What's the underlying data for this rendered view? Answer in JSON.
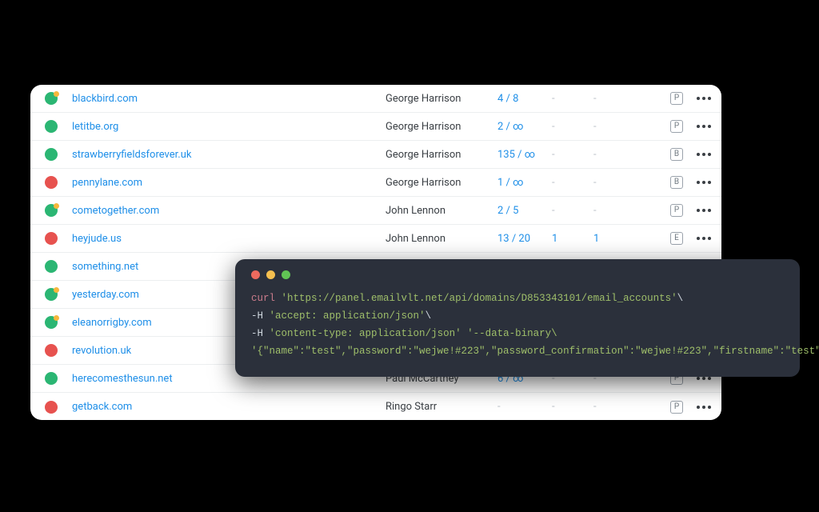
{
  "rows": [
    {
      "status": "green",
      "accent": "yellow",
      "domain": "blackbird.com",
      "owner": "George Harrison",
      "quota": "4 / 8",
      "m1": "-",
      "m2": "-",
      "badge": "P"
    },
    {
      "status": "green",
      "accent": "",
      "domain": "letitbe.org",
      "owner": "George Harrison",
      "quota": "2 / ∞",
      "m1": "-",
      "m2": "-",
      "badge": "P"
    },
    {
      "status": "green",
      "accent": "",
      "domain": "strawberryfieldsforever.uk",
      "owner": "George Harrison",
      "quota": "135 / ∞",
      "m1": "-",
      "m2": "-",
      "badge": "B"
    },
    {
      "status": "red",
      "accent": "",
      "domain": "pennylane.com",
      "owner": "George Harrison",
      "quota": "1 / ∞",
      "m1": "-",
      "m2": "-",
      "badge": "B"
    },
    {
      "status": "green",
      "accent": "yellow",
      "domain": "cometogether.com",
      "owner": "John Lennon",
      "quota": "2 / 5",
      "m1": "-",
      "m2": "-",
      "badge": "P"
    },
    {
      "status": "red",
      "accent": "",
      "domain": "heyjude.us",
      "owner": "John Lennon",
      "quota": "13 / 20",
      "m1": "1",
      "m2": "1",
      "badge": "E"
    },
    {
      "status": "green",
      "accent": "",
      "domain": "something.net",
      "owner": "",
      "quota": "",
      "m1": "",
      "m2": "",
      "badge": ""
    },
    {
      "status": "green",
      "accent": "yellow",
      "domain": "yesterday.com",
      "owner": "",
      "quota": "",
      "m1": "",
      "m2": "",
      "badge": ""
    },
    {
      "status": "green",
      "accent": "yellow",
      "domain": "eleanorrigby.com",
      "owner": "",
      "quota": "",
      "m1": "",
      "m2": "",
      "badge": ""
    },
    {
      "status": "red",
      "accent": "",
      "domain": "revolution.uk",
      "owner": "",
      "quota": "",
      "m1": "",
      "m2": "",
      "badge": ""
    },
    {
      "status": "green",
      "accent": "",
      "domain": "herecomesthesun.net",
      "owner": "Paul McCartney",
      "quota": "6 / ∞",
      "m1": "-",
      "m2": "-",
      "badge": "P"
    },
    {
      "status": "red",
      "accent": "",
      "domain": "getback.com",
      "owner": "Ringo Starr",
      "quota": "-",
      "m1": "-",
      "m2": "-",
      "badge": "P"
    }
  ],
  "terminal": {
    "cmd": "curl",
    "line1_str": "'https://panel.emailvlt.net/api/domains/D853343101/email_accounts'",
    "line1_tail": "\\",
    "line2_flag": "-H",
    "line2_str": "'accept: application/json'",
    "line2_tail": "\\",
    "line3_flag": "-H",
    "line3_str1": "'content-type: application/json'",
    "line3_str2": "'--data-binary\\",
    "line4_str": "'{\"name\":\"test\",\"password\":\"wejwe!#223\",\"password_confirmation\":\"wejwe!#223\",\"firstname\":\"test\"}'"
  }
}
